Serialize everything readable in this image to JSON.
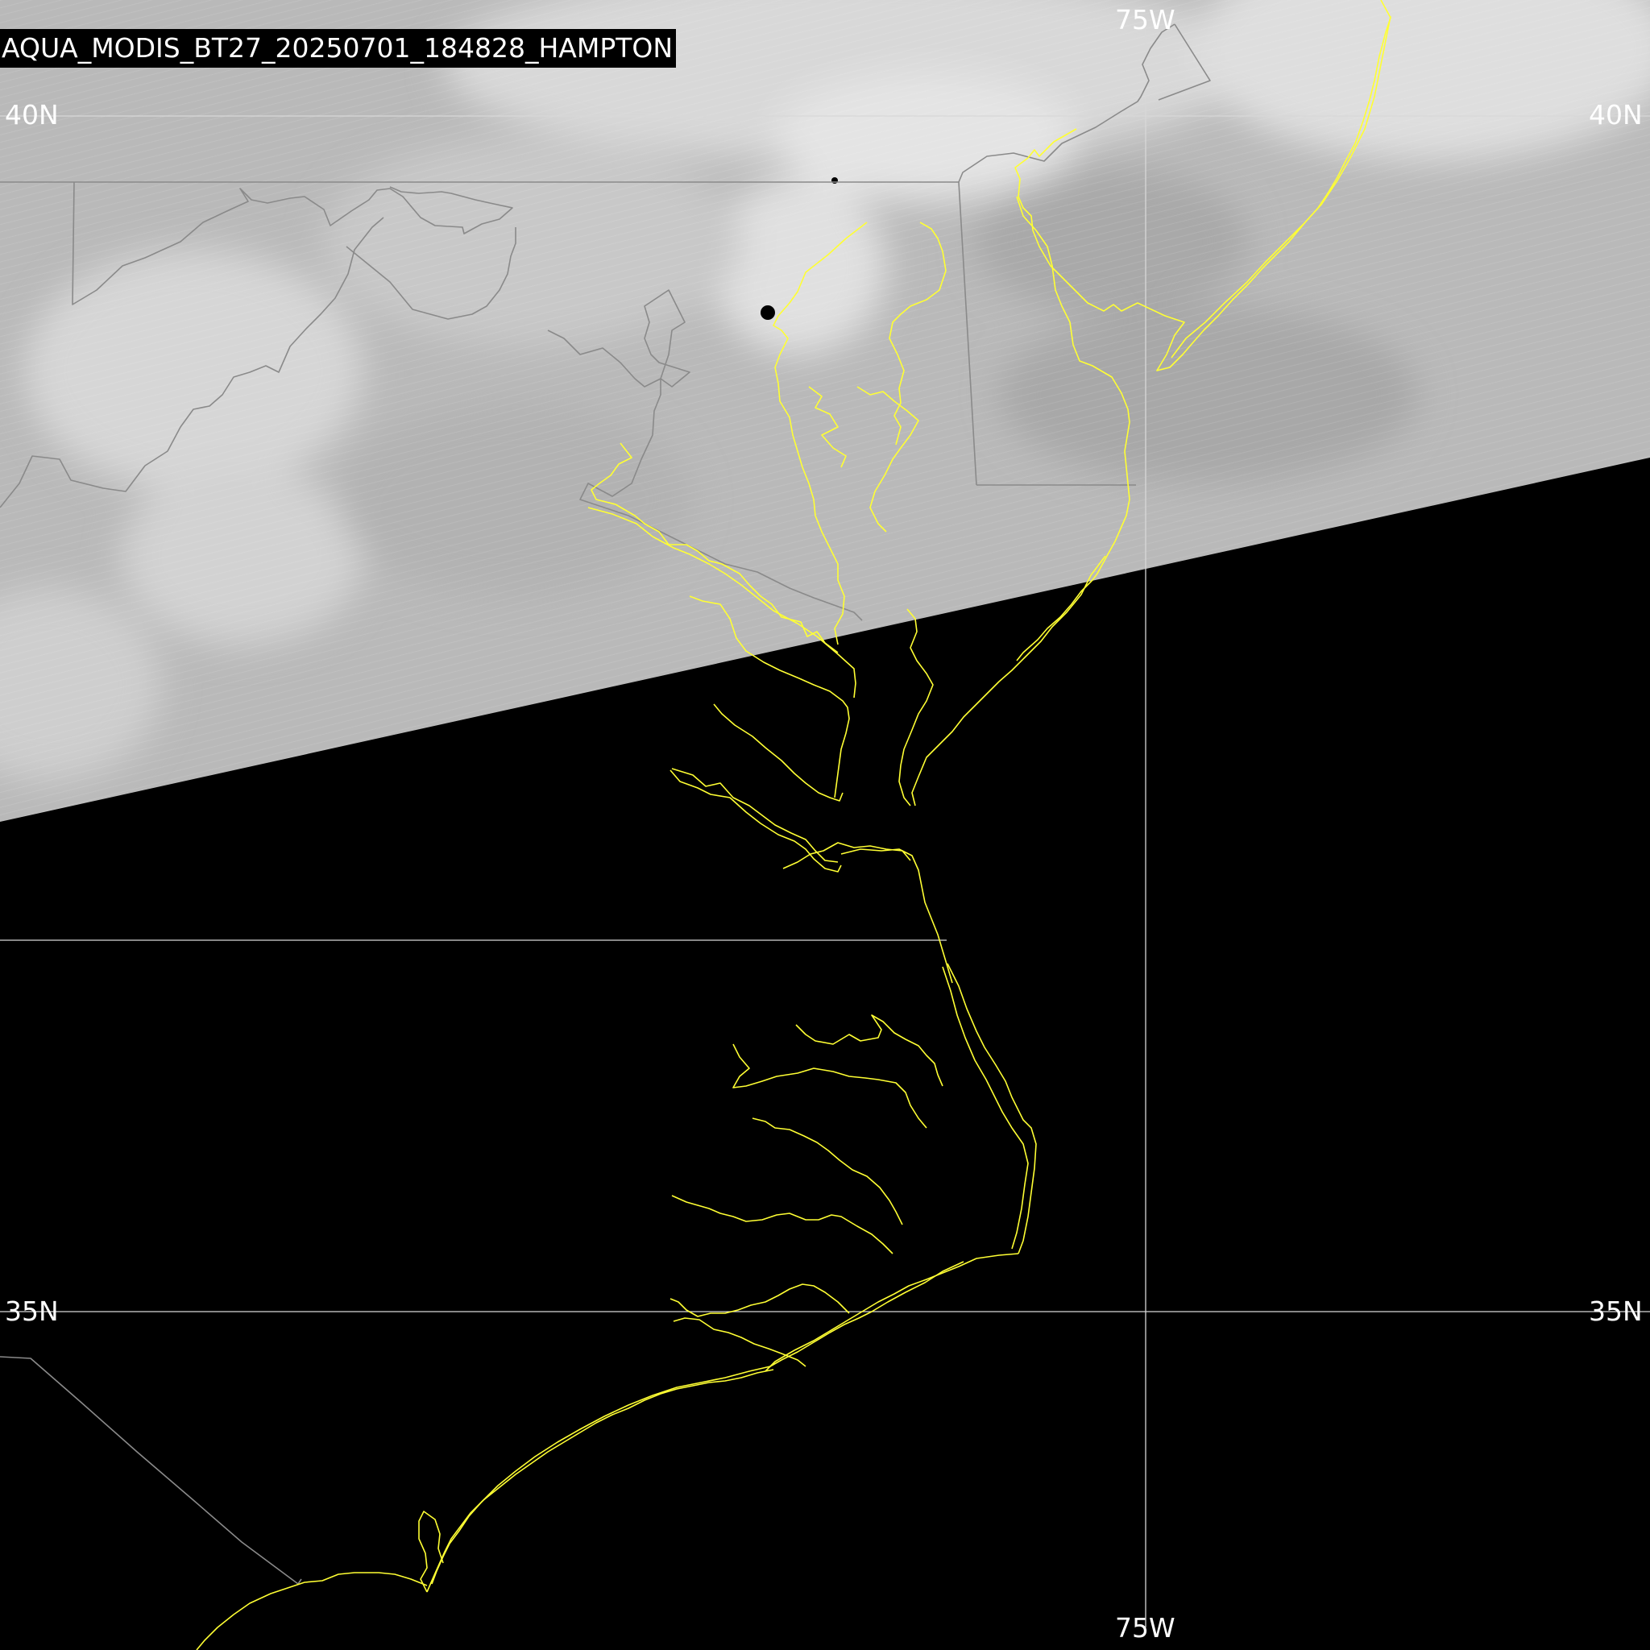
{
  "title": "AQUA_MODIS_BT27_20250701_184828_HAMPTON",
  "grid_labels": {
    "lat_top": "40N",
    "lat_bottom": "35N",
    "lon": "75W"
  },
  "colors": {
    "background": "#000000",
    "coastline": "#ffff33",
    "state_border": "#8a8a8a",
    "graticule": "#d8d8d8",
    "satellite_swath": "#bcbcbc"
  }
}
